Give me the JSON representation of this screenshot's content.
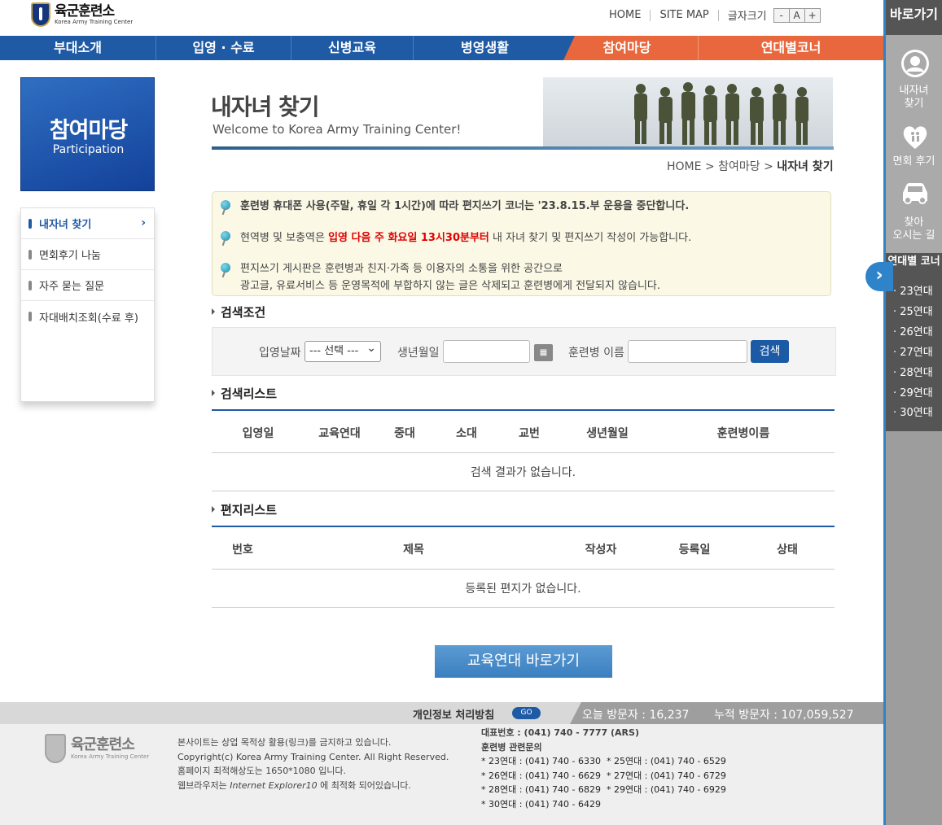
{
  "header": {
    "logo_kr": "육군훈련소",
    "logo_en": "Korea Army Training Center",
    "home": "HOME",
    "sitemap": "SITE MAP",
    "font_size": "글자크기",
    "minus": "-",
    "a": "A",
    "plus": "+"
  },
  "gnb": [
    "부대소개",
    "입영 · 수료",
    "신병교육",
    "병영생활",
    "참여마당",
    "연대별코너"
  ],
  "left": {
    "title_kr": "참여마당",
    "title_en": "Participation",
    "menu": [
      "내자녀 찾기",
      "면회후기 나눔",
      "자주 묻는 질문",
      "자대배치조회(수료 후)"
    ],
    "arrow": "›"
  },
  "page": {
    "title": "내자녀 찾기",
    "subtitle": "Welcome to Korea Army Training Center!",
    "crumb_home": "HOME",
    "crumb_mid": "참여마당",
    "crumb_cur": "내자녀 찾기",
    "sep": ">"
  },
  "notice": {
    "n1": "훈련병 휴대폰 사용(주말, 휴일 각 1시간)에 따라 편지쓰기 코너는 '23.8.15.부 운용을 중단합니다.",
    "n2_pre": "현역병 및 보충역은 ",
    "n2_red": "입영 다음 주 화요일 13시30분부터",
    "n2_post": " 내 자녀 찾기 및 편지쓰기 작성이 가능합니다.",
    "n3a": "편지쓰기 게시판은 훈련병과 친지·가족 등 이용자의 소통을 위한 공간으로",
    "n3b": "광고글, 유료서비스 등 운영목적에 부합하지 않는 글은 삭제되고 훈련병에게 전달되지 않습니다."
  },
  "search": {
    "section": "검색조건",
    "date_label": "입영날짜",
    "date_value": "--- 선택 ---",
    "birth_label": "생년월일",
    "name_label": "훈련병 이름",
    "button": "검색"
  },
  "results": {
    "section": "검색리스트",
    "headers": [
      "입영일",
      "교육연대",
      "중대",
      "소대",
      "교번",
      "생년월일",
      "훈련병이름"
    ],
    "empty": "검색 결과가 없습니다."
  },
  "letters": {
    "section": "편지리스트",
    "headers": [
      "번호",
      "제목",
      "작성자",
      "등록일",
      "상태"
    ],
    "empty": "등록된 편지가 없습니다."
  },
  "go_button": "교육연대 바로가기",
  "footer": {
    "privacy": "개인정보 처리방침",
    "go": "GO",
    "today": "오늘 방문자 : 16,237",
    "total": "누적 방문자 : 107,059,527",
    "logo_kr": "육군훈련소",
    "logo_en": "Korea Army Training Center",
    "l1": "본사이트는 상업 목적상 활용(링크)를 금지하고 있습니다.",
    "l2": "Copyright(c) Korea Army Training Center. All Right Reserved.",
    "l3": "홈페이지 최적해상도는 1650*1080 입니다.",
    "l4_pre": "웹브라우저는 ",
    "l4_em": "Internet Explorer10",
    "l4_post": " 에 최적화 되어있습니다.",
    "phone": "대표번호 : (041) 740 - 7777 (ARS)",
    "inquiry": "훈련병 관련문의",
    "p1": "* 23연대 : (041) 740 - 6330  * 25연대 : (041) 740 - 6529",
    "p2": "* 26연대 : (041) 740 - 6629  * 27연대 : (041) 740 - 6729",
    "p3": "* 28연대 : (041) 740 - 6829  * 29연대 : (041) 740 - 6929",
    "p4": "* 30연대 : (041) 740 - 6429"
  },
  "quick": {
    "title": "바로가기",
    "i1a": "내자녀",
    "i1b": "찾기",
    "i2": "면회 후기",
    "i3a": "찾아",
    "i3b": "오시는 길",
    "unit_title": "연대별 코너",
    "units": [
      "· 23연대",
      "· 25연대",
      "· 26연대",
      "· 27연대",
      "· 28연대",
      "· 29연대",
      "· 30연대"
    ],
    "arrow": "›"
  },
  "colors": {
    "nav_blue": "#1f5aa5",
    "nav_orange": "#e8673c",
    "red_text": "#e00000"
  }
}
